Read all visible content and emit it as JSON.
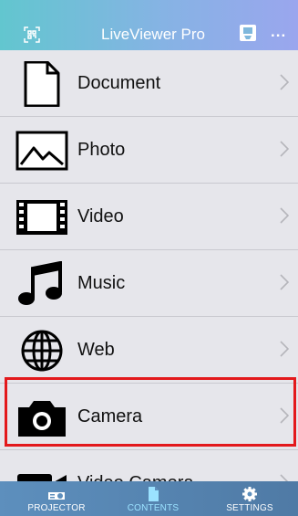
{
  "header": {
    "title": "LiveViewer Pro",
    "more_icon": "...",
    "scan_icon": "qr-scan-icon",
    "cast_icon": "screen-cast-icon"
  },
  "list": {
    "items": [
      {
        "label": "Document",
        "icon": "document-icon"
      },
      {
        "label": "Photo",
        "icon": "photo-icon"
      },
      {
        "label": "Video",
        "icon": "film-icon"
      },
      {
        "label": "Music",
        "icon": "music-note-icon"
      },
      {
        "label": "Web",
        "icon": "globe-icon"
      },
      {
        "label": "Camera",
        "icon": "camera-icon",
        "highlighted": true
      },
      {
        "label": "Video Camera",
        "icon": "video-camera-icon"
      }
    ],
    "chevron": "›"
  },
  "tabbar": {
    "tabs": [
      {
        "label": "PROJECTOR",
        "icon": "projector-icon"
      },
      {
        "label": "CONTENTS",
        "icon": "contents-icon",
        "active": true
      },
      {
        "label": "SETTINGS",
        "icon": "gear-icon"
      }
    ]
  },
  "colors": {
    "header_start": "#62c6cf",
    "header_end": "#9aa6ee",
    "list_bg": "#e6e6eb",
    "highlight": "#e3191c",
    "tabbar": "#5d8fbd",
    "active_tab": "#9be2ff"
  }
}
